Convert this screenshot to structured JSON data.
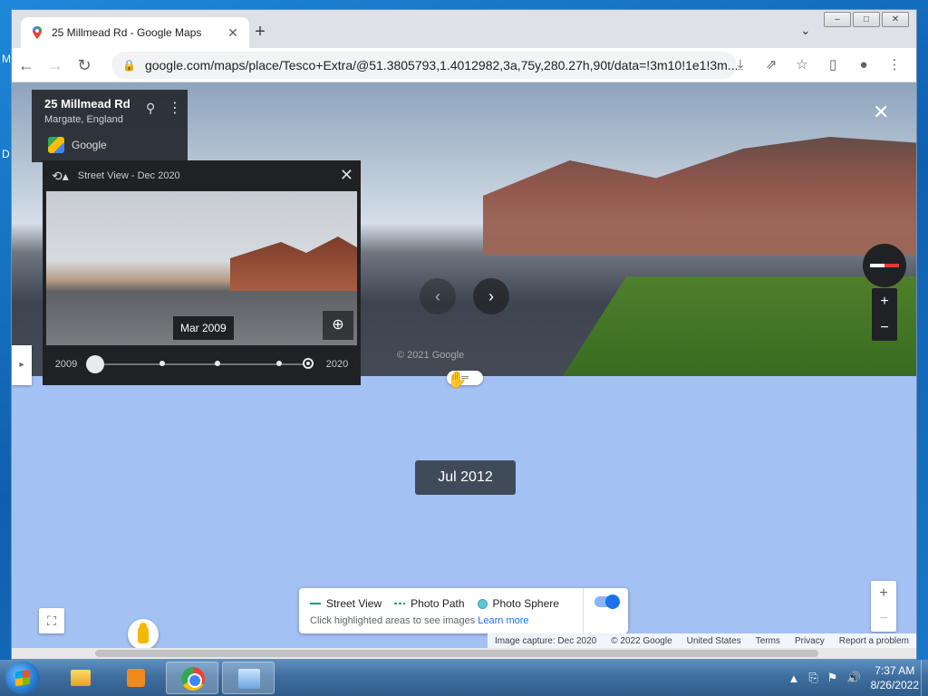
{
  "desktop": {
    "fragment_top": "M",
    "fragment_mid": "D"
  },
  "browser": {
    "tab_title": "25 Millmead Rd - Google Maps",
    "tab_close": "✕",
    "new_tab": "+",
    "tab_search": "⌄",
    "window_controls": {
      "minimize": "–",
      "maximize": "□",
      "close": "✕"
    },
    "nav": {
      "back": "←",
      "forward": "→",
      "reload": "↻"
    },
    "url": "google.com/maps/place/Tesco+Extra/@51.3805793,1.4012982,3a,75y,280.27h,90t/data=!3m10!1e1!3m...",
    "toolbar_icons": {
      "install": "⤓",
      "share": "⇗",
      "bookmark": "☆",
      "side_panel": "▯",
      "profile": "●",
      "menu": "⋮"
    }
  },
  "place_card": {
    "title": "25 Millmead Rd",
    "subtitle": "Margate, England",
    "brand": "Google",
    "pin_icon": "⚲",
    "more_icon": "⋮"
  },
  "time_machine": {
    "header": "Street View - Dec 2020",
    "history_icon": "⟲▴",
    "close": "✕",
    "date_tag": "Mar 2009",
    "zoom_icon": "⊕",
    "year_start": "2009",
    "year_end": "2020",
    "selected_fraction": 0.0
  },
  "streetview": {
    "watermark": "© 2021 Google",
    "close": "✕",
    "arrow_back": "‹",
    "arrow_forward": "›",
    "zoom_in": "+",
    "zoom_out": "−",
    "drag_handle": "═",
    "cursor": "✋"
  },
  "side_tab_arrow": "▸",
  "date_badge": "Jul 2012",
  "controls": {
    "fullscreen": "⛶"
  },
  "legend": {
    "street_view": "Street View",
    "photo_path": "Photo Path",
    "photo_sphere": "Photo Sphere",
    "hint": "Click highlighted areas to see images",
    "learn_more": "Learn more",
    "toggle_on": true
  },
  "map_zoom": {
    "in": "+",
    "out": "−"
  },
  "footer": {
    "image_capture": "Image capture: Dec 2020",
    "copyright": "© 2022 Google",
    "country": "United States",
    "terms": "Terms",
    "privacy": "Privacy",
    "report": "Report a problem"
  },
  "taskbar": {
    "apps": [
      "Windows Explorer",
      "Windows Media Player",
      "Google Chrome",
      "Control Panel"
    ],
    "tray_icons": {
      "arrow": "▲",
      "network": "⎘",
      "flag": "⚑",
      "volume": "🔊"
    },
    "time": "7:37 AM",
    "date": "8/26/2022"
  }
}
